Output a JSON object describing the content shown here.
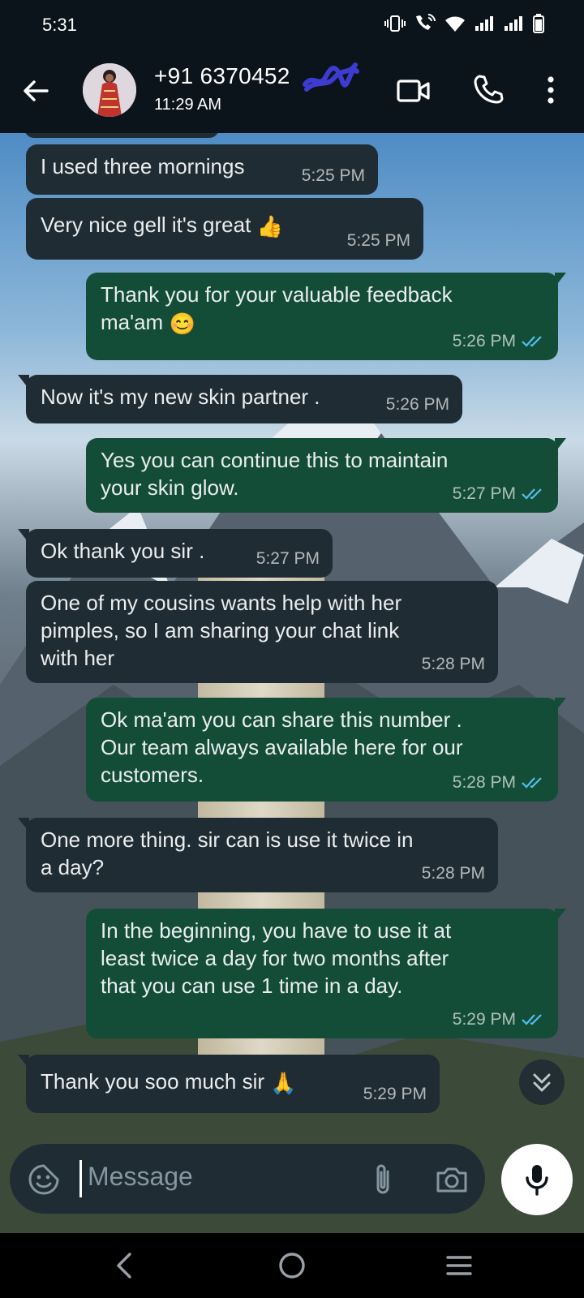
{
  "status_bar": {
    "time": "5:31"
  },
  "header": {
    "contact_name": "+91 6370452",
    "last_seen": "11:29 AM"
  },
  "messages": [
    {
      "dir": "in",
      "text": "I used three mornings",
      "time": "5:25 PM"
    },
    {
      "dir": "in",
      "text": "Very nice gell it's great",
      "emoji": "👍",
      "time": "5:25 PM"
    },
    {
      "dir": "out",
      "text": "Thank you for your valuable feedback\nma'am",
      "emoji": "😊",
      "time": "5:26 PM",
      "read": true
    },
    {
      "dir": "in",
      "text": "Now it's my new skin partner .",
      "time": "5:26 PM"
    },
    {
      "dir": "out",
      "text": "Yes you can continue this to maintain\nyour skin glow.",
      "time": "5:27 PM",
      "read": true
    },
    {
      "dir": "in",
      "text": "Ok thank you  sir .",
      "time": "5:27 PM"
    },
    {
      "dir": "in",
      "text": "One of my cousins wants help with her\npimples, so I am sharing your chat link\nwith her",
      "time": "5:28 PM"
    },
    {
      "dir": "out",
      "text": "Ok ma'am you can share this number .\nOur team always available here for our\ncustomers.",
      "time": "5:28 PM",
      "read": true
    },
    {
      "dir": "in",
      "text": "One more thing. sir can is use it twice in\na day?",
      "time": "5:28 PM"
    },
    {
      "dir": "out",
      "text": "In the beginning, you have to use it at\nleast twice a day for two months after\nthat you can use 1 time in a day.",
      "time": "5:29 PM",
      "read": true
    },
    {
      "dir": "in",
      "text": "Thank you soo much sir",
      "emoji": "🙏",
      "time": "5:29 PM"
    }
  ],
  "composer": {
    "placeholder": "Message"
  },
  "colors": {
    "incoming_bubble": "#202c33",
    "outgoing_bubble": "#134d37",
    "read_ticks": "#53bdeb",
    "app_bar": "#0b141a"
  }
}
